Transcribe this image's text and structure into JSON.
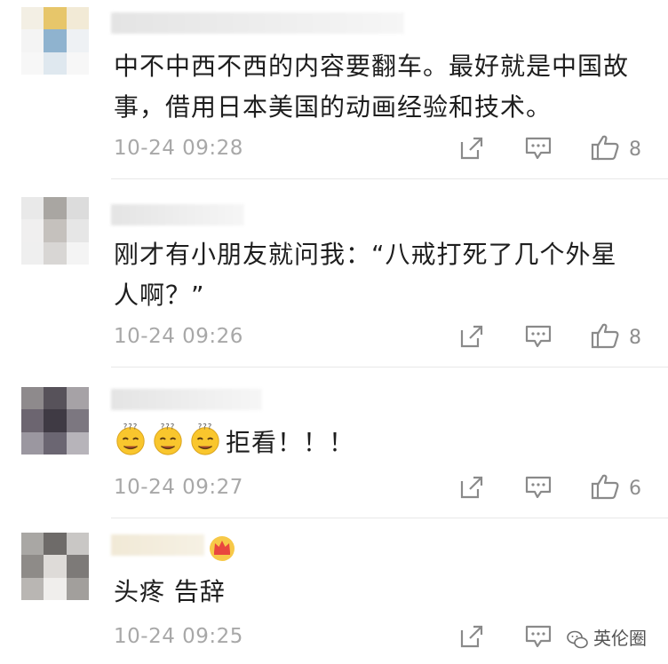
{
  "comments": [
    {
      "text": "中不中西不西的内容要翻车。最好就是中国故事，借用日本美国的动画经验和技术。",
      "time": "10-24 09:28",
      "likes": "8",
      "avatar_colors": [
        "#f3efe4",
        "#e7c66a",
        "#f2ead6",
        "#f4f4f4",
        "#8fb3cf",
        "#eef1f4",
        "#f7f7f7",
        "#dfe8ef",
        "#f7f7f7"
      ]
    },
    {
      "text": "刚才有小朋友就问我：“八戒打死了几个外星人啊？”",
      "time": "10-24 09:26",
      "likes": "8",
      "avatar_colors": [
        "#e9e9e9",
        "#a9a6a2",
        "#dcdcdc",
        "#f0efef",
        "#c5c1bd",
        "#e6e6e6",
        "#efefef",
        "#d8d6d4",
        "#f4f4f4"
      ]
    },
    {
      "text": "拒看！！！",
      "time": "10-24 09:27",
      "likes": "6",
      "emoji_count": 3,
      "avatar_colors": [
        "#8e8a8c",
        "#57525a",
        "#a6a2a6",
        "#6c6570",
        "#3f3a44",
        "#7c7780",
        "#9b97a0",
        "#6b6672",
        "#b7b4ba"
      ]
    },
    {
      "text": "头疼 告辞",
      "time": "10-24 09:25",
      "likes": "",
      "vip_badge": "crown",
      "avatar_colors": [
        "#a9a7a4",
        "#6e6b69",
        "#c9c7c5",
        "#8e8b88",
        "#dedbd8",
        "#7d7a78",
        "#b9b6b3",
        "#f0eeec",
        "#a29f9c"
      ]
    }
  ],
  "watermark": "英伦圈",
  "colors": {
    "text": "#1e1e1e",
    "meta": "#a8a8a8",
    "icon": "#8a8a8a",
    "divider": "#e8e8e8"
  }
}
